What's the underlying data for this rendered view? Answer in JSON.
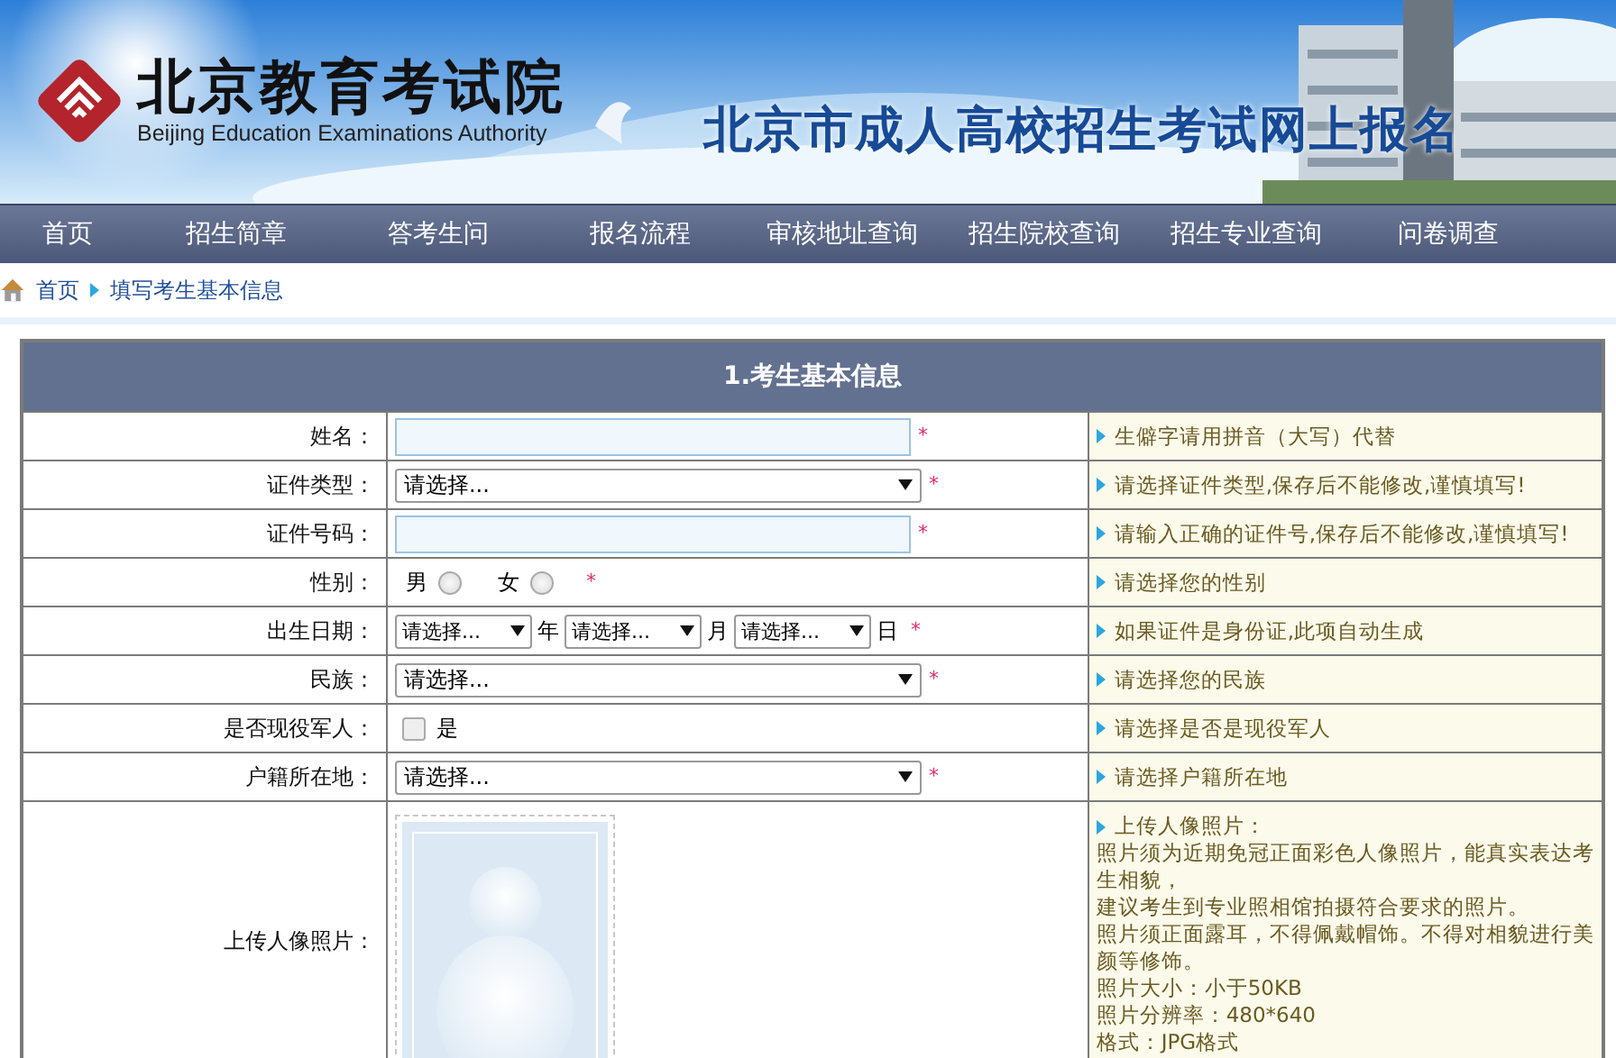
{
  "header": {
    "org_name": "北京教育考试院",
    "org_name_en": "Beijing Education Examinations Authority",
    "site_title": "北京市成人高校招生考试网上报名"
  },
  "nav": [
    {
      "label": "首页"
    },
    {
      "label": "招生简章"
    },
    {
      "label": "答考生问"
    },
    {
      "label": "报名流程"
    },
    {
      "label": "审核地址查询"
    },
    {
      "label": "招生院校查询"
    },
    {
      "label": "招生专业查询"
    },
    {
      "label": "问卷调查"
    }
  ],
  "breadcrumb": [
    "首页",
    "填写考生基本信息"
  ],
  "form": {
    "title": "1.考生基本信息",
    "rows": [
      {
        "kind": "text",
        "label": "姓名：",
        "required_mark": "*",
        "hint": "生僻字请用拼音（大写）代替"
      },
      {
        "kind": "select",
        "label": "证件类型：",
        "value": "请选择...",
        "required_mark": "*",
        "hint": "请选择证件类型,保存后不能修改,谨慎填写!"
      },
      {
        "kind": "text",
        "label": "证件号码：",
        "required_mark": "*",
        "hint": "请输入正确的证件号,保存后不能修改,谨慎填写!"
      },
      {
        "kind": "radio",
        "label": "性别：",
        "options": [
          {
            "label": "男",
            "selected": false
          },
          {
            "label": "女",
            "selected": false
          }
        ],
        "required_mark": "*",
        "hint": "请选择您的性别"
      },
      {
        "kind": "date",
        "label": "出生日期：",
        "parts": [
          {
            "value": "请选择...",
            "unit": "年"
          },
          {
            "value": "请选择...",
            "unit": "月"
          },
          {
            "value": "请选择...",
            "unit": "日"
          }
        ],
        "required_mark": "*",
        "hint": "如果证件是身份证,此项自动生成"
      },
      {
        "kind": "select",
        "label": "民族：",
        "value": "请选择...",
        "required_mark": "*",
        "hint": "请选择您的民族"
      },
      {
        "kind": "checkbox",
        "label": "是否现役军人：",
        "option": "是",
        "checked": false,
        "hint": "请选择是否是现役军人"
      },
      {
        "kind": "select",
        "label": "户籍所在地：",
        "value": "请选择...",
        "required_mark": "*",
        "hint": "请选择户籍所在地"
      },
      {
        "label": "上传人像照片：",
        "hint": "上传人像照片：",
        "hint_lines": [
          "照片须为近期免冠正面彩色人像照片，能真实表达考生相貌，",
          "建议考生到专业照相馆拍摄符合要求的照片。",
          "照片须正面露耳，不得佩戴帽饰。不得对相貌进行美颜等修饰。",
          "照片大小：小于50KB",
          "照片分辨率：480*640",
          "格式：JPG格式"
        ]
      }
    ]
  }
}
